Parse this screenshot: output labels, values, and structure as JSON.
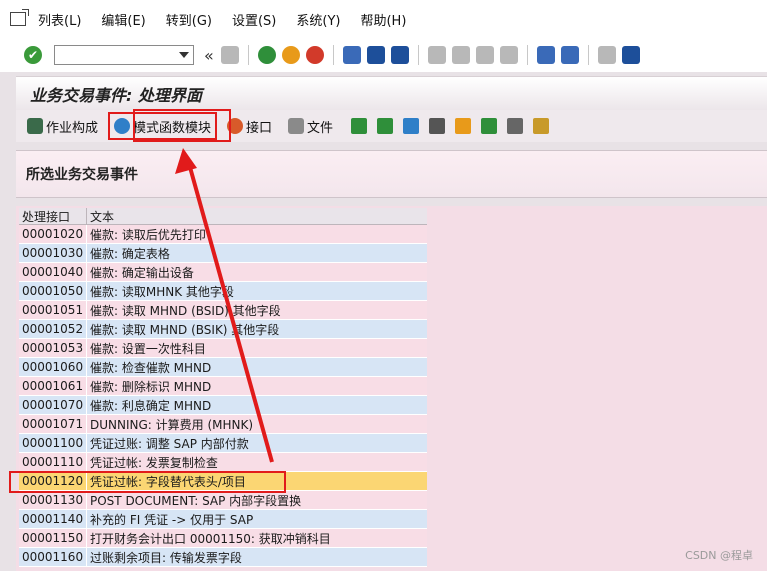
{
  "menubar": {
    "items": [
      "列表(L)",
      "编辑(E)",
      "转到(G)",
      "设置(S)",
      "系统(Y)",
      "帮助(H)"
    ]
  },
  "toolbar": {
    "back_glyph": "«",
    "ok_glyph": "✔"
  },
  "screen": {
    "title": "业务交易事件: 处理界面"
  },
  "app_toolbar": {
    "items": [
      "作业构成",
      "模式函数模块",
      "接口",
      "文件"
    ]
  },
  "section": {
    "title": "所选业务交易事件"
  },
  "table": {
    "columns": [
      "处理接口",
      "文本"
    ],
    "rows": [
      [
        "00001020",
        "催款: 读取后优先打印"
      ],
      [
        "00001030",
        "催款: 确定表格"
      ],
      [
        "00001040",
        "催款: 确定输出设备"
      ],
      [
        "00001050",
        "催款: 读取MHNK 其他字段"
      ],
      [
        "00001051",
        "催款: 读取 MHND (BSID) 其他字段"
      ],
      [
        "00001052",
        "催款: 读取 MHND (BSIK) 其他字段"
      ],
      [
        "00001053",
        "催款: 设置一次性科目"
      ],
      [
        "00001060",
        "催款: 检查催款 MHND"
      ],
      [
        "00001061",
        "催款:  删除标识 MHND"
      ],
      [
        "00001070",
        "催款:  利息确定 MHND"
      ],
      [
        "00001071",
        "DUNNING: 计算费用 (MHNK)"
      ],
      [
        "00001100",
        "凭证过账: 调整 SAP 内部付款"
      ],
      [
        "00001110",
        "凭证过帐: 发票复制检查"
      ],
      [
        "00001120",
        "凭证过帐: 字段替代表头/项目"
      ],
      [
        "00001130",
        "POST DOCUMENT: SAP 内部字段置换"
      ],
      [
        "00001140",
        "补充的 FI 凭证 -> 仅用于 SAP"
      ],
      [
        "00001150",
        "打开财务会计出口 00001150: 获取冲销科目"
      ],
      [
        "00001160",
        "过账剩余项目: 传输发票字段"
      ]
    ],
    "selected_index": 13
  },
  "watermark": "CSDN @程卓"
}
